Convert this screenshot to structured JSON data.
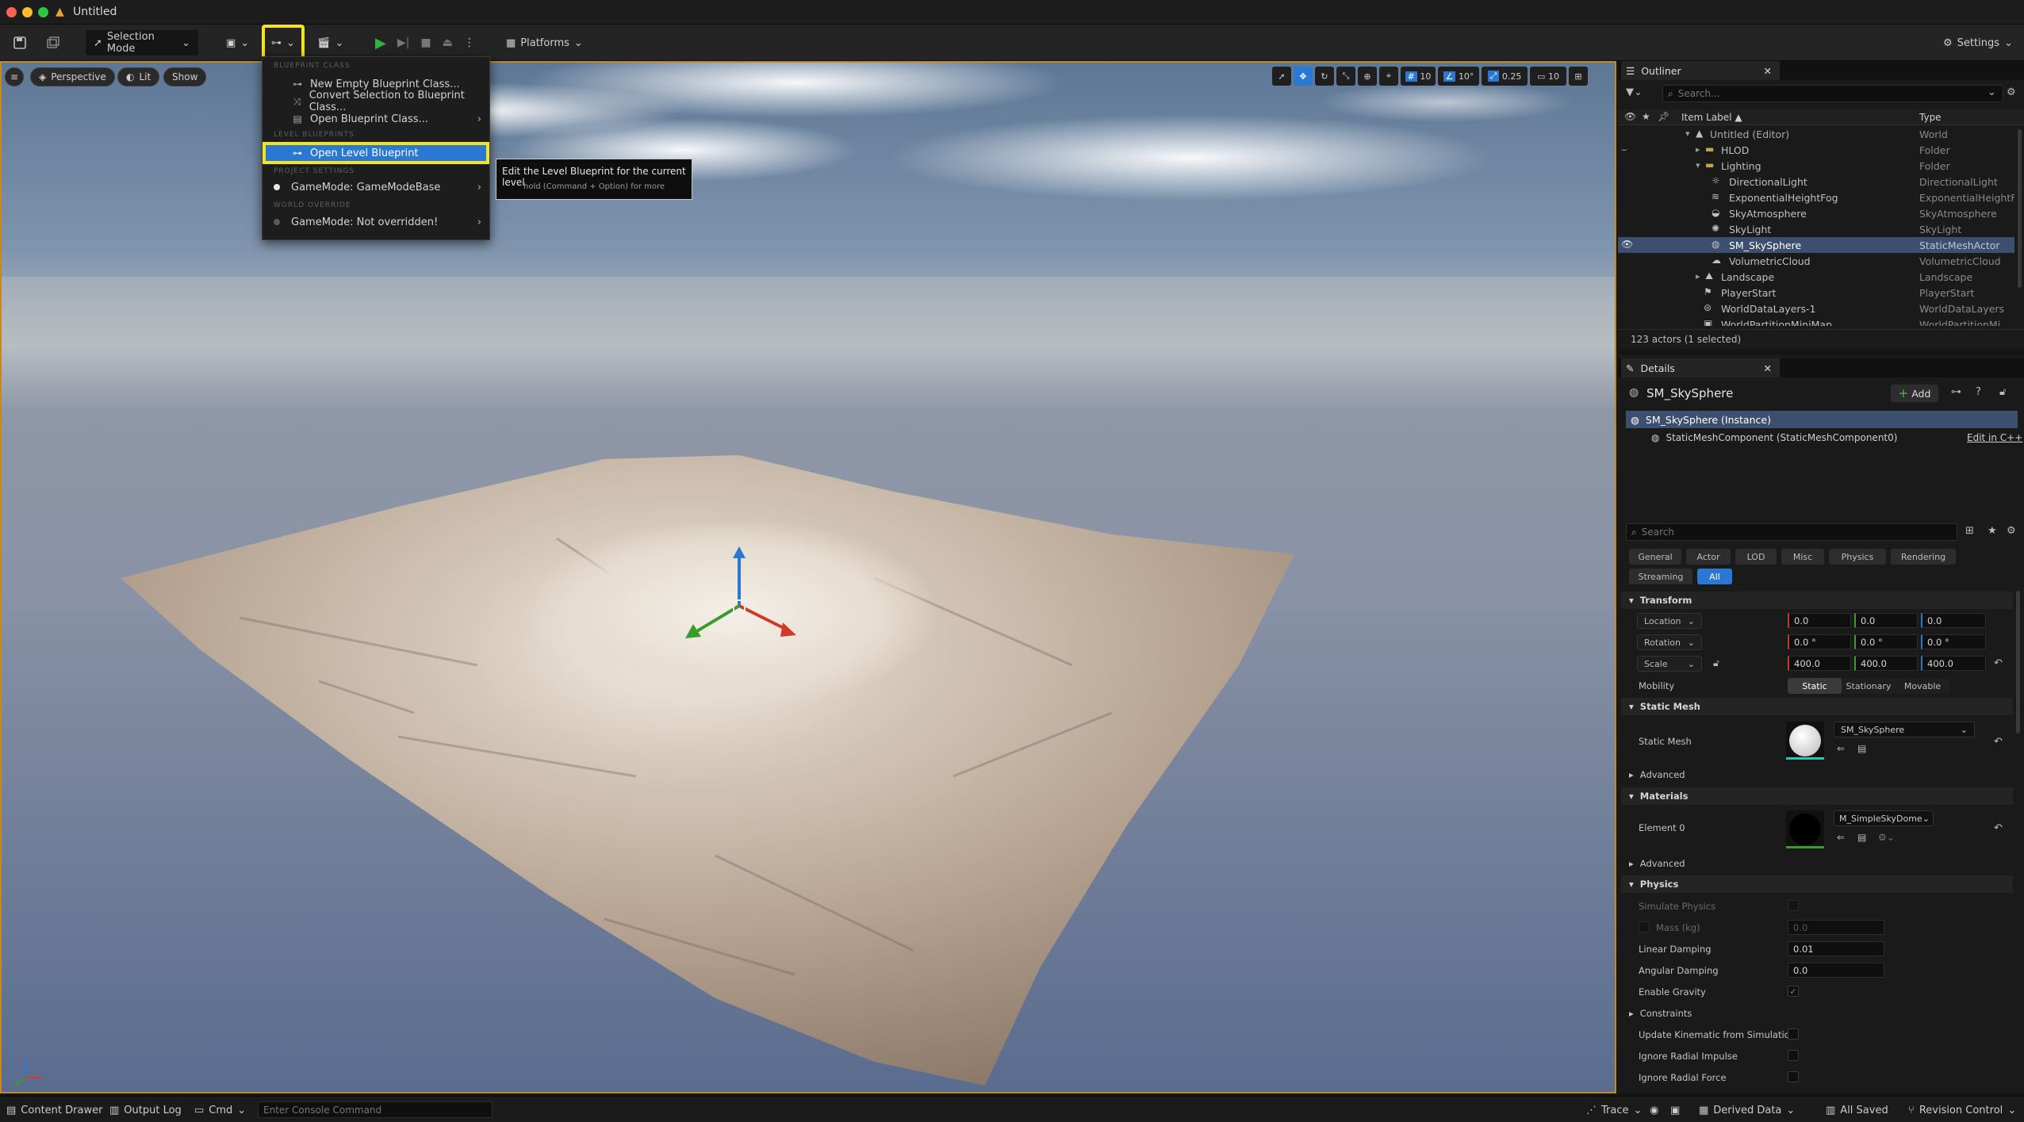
{
  "window": {
    "title": "Untitled"
  },
  "toolbar": {
    "selection_mode": "Selection Mode",
    "platforms": "Platforms",
    "settings": "Settings"
  },
  "viewport": {
    "perspective": "Perspective",
    "lit": "Lit",
    "show": "Show",
    "grid_snap": "10",
    "rotation_snap": "10°",
    "scale_snap": "0.25",
    "camera_speed": "10"
  },
  "blueprint_menu": {
    "section_blueprint_class": "BLUEPRINT CLASS",
    "new_empty": "New Empty Blueprint Class...",
    "convert_selection": "Convert Selection to Blueprint Class...",
    "open_class": "Open Blueprint Class...",
    "section_level": "LEVEL BLUEPRINTS",
    "open_level": "Open Level Blueprint",
    "section_project": "PROJECT SETTINGS",
    "gamemode_base": "GameMode: GameModeBase",
    "section_world": "WORLD OVERRIDE",
    "gamemode_override": "GameMode: Not overridden!"
  },
  "tooltip": {
    "title": "Edit the Level Blueprint for the current level",
    "hint": "hold (Command + Option) for more"
  },
  "outliner": {
    "tab": "Outliner",
    "search_placeholder": "Search...",
    "col_label": "Item Label ▲",
    "col_type": "Type",
    "rows": [
      {
        "label": "Untitled (Editor)",
        "type": "World"
      },
      {
        "label": "HLOD",
        "type": "Folder"
      },
      {
        "label": "Lighting",
        "type": "Folder"
      },
      {
        "label": "DirectionalLight",
        "type": "DirectionalLight"
      },
      {
        "label": "ExponentialHeightFog",
        "type": "ExponentialHeightF"
      },
      {
        "label": "SkyAtmosphere",
        "type": "SkyAtmosphere"
      },
      {
        "label": "SkyLight",
        "type": "SkyLight"
      },
      {
        "label": "SM_SkySphere",
        "type": "StaticMeshActor"
      },
      {
        "label": "VolumetricCloud",
        "type": "VolumetricCloud"
      },
      {
        "label": "Landscape",
        "type": "Landscape"
      },
      {
        "label": "PlayerStart",
        "type": "PlayerStart"
      },
      {
        "label": "WorldDataLayers-1",
        "type": "WorldDataLayers"
      },
      {
        "label": "WorldPartitionMiniMap",
        "type": "WorldPartitionMi"
      }
    ],
    "status": "123 actors (1 selected)"
  },
  "details": {
    "tab": "Details",
    "actor_name": "SM_SkySphere",
    "add": "Add",
    "instance": "SM_SkySphere (Instance)",
    "component": "StaticMeshComponent (StaticMeshComponent0)",
    "edit_cpp": "Edit in C++",
    "search_placeholder": "Search",
    "filters": [
      "General",
      "Actor",
      "LOD",
      "Misc",
      "Physics",
      "Rendering",
      "Streaming",
      "All"
    ],
    "transform": {
      "header": "Transform",
      "location_label": "Location",
      "location": [
        "0.0",
        "0.0",
        "0.0"
      ],
      "rotation_label": "Rotation",
      "rotation": [
        "0.0 °",
        "0.0 °",
        "0.0 °"
      ],
      "scale_label": "Scale",
      "scale": [
        "400.0",
        "400.0",
        "400.0"
      ],
      "mobility_label": "Mobility",
      "mobility_options": [
        "Static",
        "Stationary",
        "Movable"
      ]
    },
    "static_mesh": {
      "header": "Static Mesh",
      "label": "Static Mesh",
      "value": "SM_SkySphere",
      "advanced": "Advanced"
    },
    "materials": {
      "header": "Materials",
      "element_label": "Element 0",
      "value": "M_SimpleSkyDome",
      "advanced": "Advanced"
    },
    "physics": {
      "header": "Physics",
      "simulate": "Simulate Physics",
      "mass_label": "Mass (kg)",
      "mass": "0.0",
      "linear_damping_label": "Linear Damping",
      "linear_damping": "0.01",
      "angular_damping_label": "Angular Damping",
      "angular_damping": "0.0",
      "gravity_label": "Enable Gravity",
      "constraints": "Constraints",
      "kinematic": "Update Kinematic from Simulation",
      "radial_impulse": "Ignore Radial Impulse",
      "radial_force": "Ignore Radial Force"
    }
  },
  "statusbar": {
    "content_drawer": "Content Drawer",
    "output_log": "Output Log",
    "cmd": "Cmd",
    "console_placeholder": "Enter Console Command",
    "trace": "Trace",
    "derived_data": "Derived Data",
    "all_saved": "All Saved",
    "revision_control": "Revision Control"
  },
  "colors": {
    "accent": "#2a78d4",
    "highlight": "#f2e51e",
    "play": "#2fb63c"
  }
}
